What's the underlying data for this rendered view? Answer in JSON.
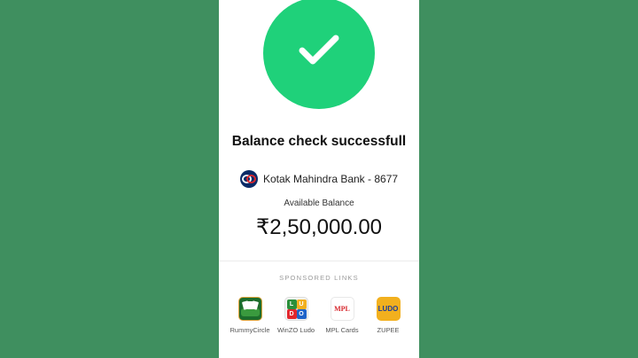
{
  "status": {
    "title": "Balance check successfull",
    "icon": "checkmark-icon",
    "accent_color": "#1fd17a"
  },
  "account": {
    "bank_icon": "kotak-bank-logo-icon",
    "bank_name": "Kotak Mahindra Bank - 8677"
  },
  "balance": {
    "label": "Available Balance",
    "amount": "₹2,50,000.00"
  },
  "sponsored": {
    "header": "SPONSORED LINKS",
    "apps": [
      {
        "label": "RummyCircle",
        "icon": "rummycircle-app-icon"
      },
      {
        "label": "WinZO Ludo",
        "icon": "winzo-ludo-app-icon"
      },
      {
        "label": "MPL Cards",
        "icon": "mpl-cards-app-icon"
      },
      {
        "label": "ZUPEE",
        "icon": "zupee-app-icon"
      }
    ],
    "mpl_text": "MPL",
    "zupee_text": "LUDO"
  },
  "colors": {
    "background": "#3f8f5f",
    "panel": "#ffffff"
  }
}
